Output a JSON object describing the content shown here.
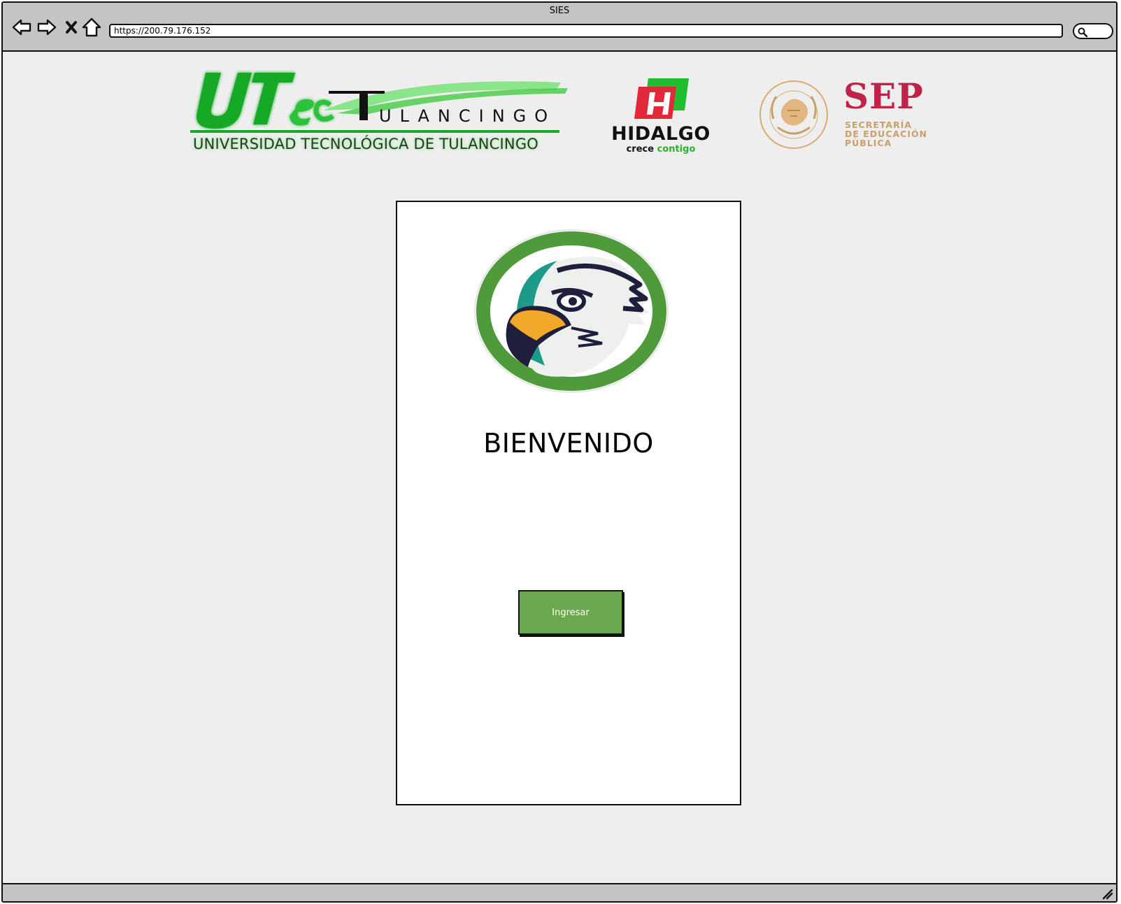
{
  "window": {
    "title": "SIES",
    "address": "https://200.79.176.152"
  },
  "nav": {
    "back_icon": "arrow-left-icon",
    "forward_icon": "arrow-right-icon",
    "stop_icon": "close-icon",
    "home_icon": "home-icon",
    "search_icon": "search-icon"
  },
  "header": {
    "utec": {
      "mark": "UTec",
      "name_line": "ULANCINGO",
      "subtitle": "UNIVERSIDAD TECNOLÓGICA DE TULANCINGO"
    },
    "hidalgo": {
      "title": "HIDALGO",
      "tag_crece": "crece",
      "tag_contigo": "contigo"
    },
    "sep": {
      "title": "SEP",
      "sub_line1": "SECRETARÍA",
      "sub_line2": "DE EDUCACIÓN",
      "sub_line3": "PÚBLICA",
      "seal_text": "ESTADOS UNIDOS MEXICANOS"
    }
  },
  "card": {
    "welcome": "BIENVENIDO",
    "button_label": "Ingresar"
  },
  "colors": {
    "accent_green": "#6aa84f",
    "utec_green": "#19a928",
    "sep_red": "#c0224a",
    "sep_gold": "#c9a06a"
  }
}
